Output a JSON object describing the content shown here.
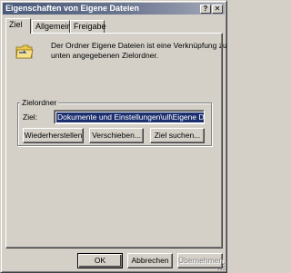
{
  "window": {
    "title": "Eigenschaften von Eigene Dateien",
    "help_button": "?",
    "close_button": "✕"
  },
  "tabs": [
    {
      "label": "Ziel",
      "active": true
    },
    {
      "label": "Allgemein",
      "active": false
    },
    {
      "label": "Freigabe",
      "active": false
    }
  ],
  "panel": {
    "icon": "folder-shortcut-icon",
    "description_lines": [
      "Der Ordner Eigene Dateien ist eine Verknüpfung zum",
      "unten angegebenen Zielordner."
    ],
    "group_label": "Zielordner",
    "target_label": "Ziel:",
    "target_value": "Dokumente und Einstellungen\\ull\\Eigene Dateien",
    "buttons": {
      "restore": "Wiederherstellen",
      "move": "Verschieben...",
      "find_target": "Ziel suchen..."
    }
  },
  "footer": {
    "ok": "OK",
    "cancel": "Abbrechen",
    "apply": "Übernehmen"
  },
  "colors": {
    "face": "#d4d0c8",
    "titlebar_start": "#4a5a7a",
    "titlebar_end": "#a6aab8",
    "selection": "#1c2f6e"
  }
}
